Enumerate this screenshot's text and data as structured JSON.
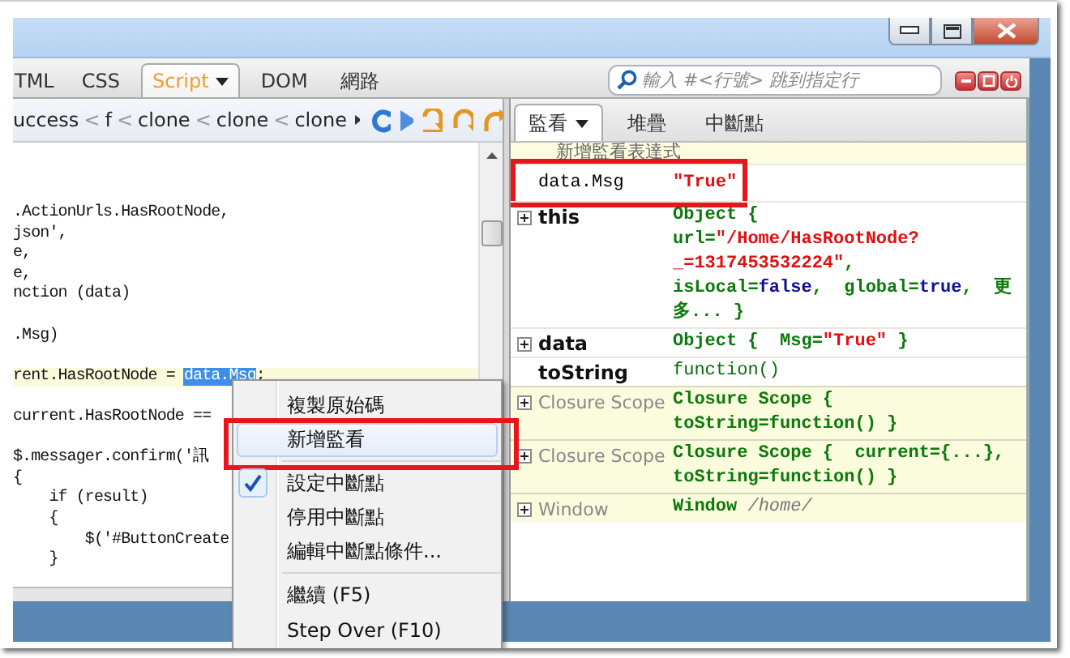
{
  "panel_tabs": [
    {
      "label": "TML",
      "selected": false,
      "dropdown": false
    },
    {
      "label": "CSS",
      "selected": false,
      "dropdown": false
    },
    {
      "label": "Script",
      "selected": true,
      "dropdown": true
    },
    {
      "label": "DOM",
      "selected": false,
      "dropdown": false
    },
    {
      "label": "網路",
      "selected": false,
      "dropdown": false
    }
  ],
  "search": {
    "placeholder": "輸入 #<行號> 跳到指定行"
  },
  "breadcrumb": {
    "separator": "<",
    "items": [
      "uccess",
      "f",
      "clone",
      "clone",
      "clone"
    ]
  },
  "code_lines": [
    {
      "kind": "code",
      "text": ".ActionUrls.HasRootNode,"
    },
    {
      "kind": "code",
      "text": "json',"
    },
    {
      "kind": "code",
      "text": "e,"
    },
    {
      "kind": "code",
      "text": "e,"
    },
    {
      "kind": "code",
      "text": "nction (data)"
    },
    {
      "kind": "blank"
    },
    {
      "kind": "code",
      "text": ".Msg)"
    },
    {
      "kind": "blank"
    },
    {
      "kind": "current",
      "text": "rent.HasRootNode = ",
      "selection": "data.Msg",
      "rest": ";"
    },
    {
      "kind": "blank"
    },
    {
      "kind": "code",
      "text": "current.HasRootNode =="
    },
    {
      "kind": "blank"
    },
    {
      "kind": "code",
      "text": "$.messager.confirm('訊"
    },
    {
      "kind": "code",
      "text": "{"
    },
    {
      "kind": "code",
      "text": "    if (result)"
    },
    {
      "kind": "code",
      "text": "    {"
    },
    {
      "kind": "code",
      "text": "        $('#ButtonCreate"
    },
    {
      "kind": "code",
      "text": "    }"
    }
  ],
  "watch_tabs": [
    {
      "label": "監看",
      "selected": true,
      "dropdown": true
    },
    {
      "label": "堆疊",
      "selected": false,
      "dropdown": false
    },
    {
      "label": "中斷點",
      "selected": false,
      "dropdown": false
    }
  ],
  "watch": {
    "new_expression": "新增監看表達式",
    "rows": [
      {
        "kind": "watch",
        "name": "data.Msg",
        "expandable": false,
        "boxed": true,
        "value": [
          {
            "kind": "string",
            "text": "\"True\""
          }
        ]
      },
      {
        "kind": "property",
        "name": "this",
        "expandable": true,
        "boxed": false,
        "value": [
          {
            "kind": "object",
            "text": "Object {  url="
          },
          {
            "kind": "string",
            "text": "\"/Home/HasRootNode?_=1317453532224\""
          },
          {
            "kind": "object",
            "text": ",  isLocal="
          },
          {
            "kind": "boolean",
            "text": "false"
          },
          {
            "kind": "object",
            "text": ",  global="
          },
          {
            "kind": "boolean",
            "text": "true"
          },
          {
            "kind": "object",
            "text": ",  更多... }"
          }
        ]
      },
      {
        "kind": "property",
        "name": "data",
        "expandable": true,
        "boxed": false,
        "value": [
          {
            "kind": "object",
            "text": "Object {  Msg="
          },
          {
            "kind": "string",
            "text": "\"True\""
          },
          {
            "kind": "object",
            "text": " }"
          }
        ]
      },
      {
        "kind": "property",
        "name": "toString",
        "expandable": false,
        "boxed": false,
        "value": [
          {
            "kind": "function",
            "text": "function()"
          }
        ]
      },
      {
        "kind": "scope",
        "name": "Closure Scope",
        "expandable": true,
        "boxed": false,
        "value": [
          {
            "kind": "object",
            "text": "Closure Scope {  toString=function() }"
          }
        ]
      },
      {
        "kind": "scope",
        "name": "Closure Scope",
        "expandable": true,
        "boxed": false,
        "value": [
          {
            "kind": "object",
            "text": "Closure Scope {  current={...},  toString=function() }"
          }
        ]
      },
      {
        "kind": "scope",
        "name": "Window",
        "expandable": true,
        "boxed": false,
        "value": [
          {
            "kind": "object",
            "text": "Window "
          },
          {
            "kind": "path",
            "text": "/home/"
          }
        ]
      }
    ]
  },
  "context_menu": [
    {
      "kind": "item",
      "label": "複製原始碼",
      "selected": false,
      "checked": false,
      "boxed": false
    },
    {
      "kind": "item",
      "label": "新增監看",
      "selected": true,
      "checked": false,
      "boxed": true
    },
    {
      "kind": "separator"
    },
    {
      "kind": "item",
      "label": "設定中斷點",
      "selected": false,
      "checked": true,
      "boxed": false
    },
    {
      "kind": "item",
      "label": "停用中斷點",
      "selected": false,
      "checked": false,
      "boxed": false
    },
    {
      "kind": "item",
      "label": "編輯中斷點條件...",
      "selected": false,
      "checked": false,
      "boxed": false
    },
    {
      "kind": "separator"
    },
    {
      "kind": "item",
      "label": "繼續 (F5)",
      "selected": false,
      "checked": false,
      "boxed": false
    },
    {
      "kind": "item",
      "label": "Step Over (F10)",
      "selected": false,
      "checked": false,
      "boxed": false
    }
  ]
}
